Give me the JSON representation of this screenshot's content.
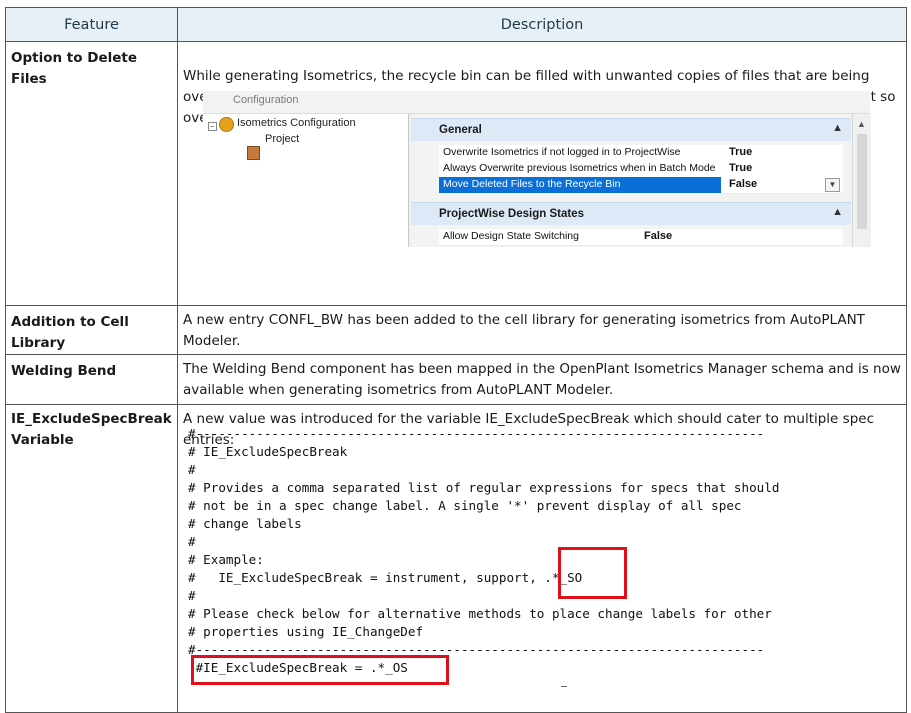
{
  "table": {
    "header": {
      "feature": "Feature",
      "description": "Description"
    },
    "rows": [
      {
        "feature": "Option to Delete Files",
        "description": "While generating Isometrics, the recycle bin can be filled with unwanted copies of files that are being overwritten. An option has been added to the Isometrics Configuration Project page which you can set so overwritten files are not sent to the recycle bin."
      },
      {
        "feature": "Addition to Cell Library",
        "description": "A new entry CONFL_BW has been added to the cell library for generating isometrics from AutoPLANT Modeler."
      },
      {
        "feature": "Welding Bend",
        "description": "The Welding Bend component has been mapped in the OpenPlant Isometrics Manager schema and is now available when generating isometrics from AutoPLANT Modeler."
      },
      {
        "feature": "IE_ExcludeSpecBreak Variable",
        "description": "A new value was introduced for the variable IE_ExcludeSpecBreak which should cater to multiple spec entries:"
      }
    ]
  },
  "screenshot": {
    "title": "Configuration",
    "tree": {
      "root": "Isometrics Configuration",
      "child": "Project"
    },
    "groups": [
      {
        "name": "General",
        "properties": [
          {
            "name": "Overwrite Isometrics if not logged in to ProjectWise",
            "value": "True"
          },
          {
            "name": "Always Overwrite previous Isometrics when in Batch Mode",
            "value": "True"
          },
          {
            "name": "Move Deleted Files to the Recycle Bin",
            "value": "False",
            "selected": true
          }
        ]
      },
      {
        "name": "ProjectWise Design States",
        "properties": [
          {
            "name": "Allow Design State Switching",
            "value": "False"
          }
        ]
      }
    ]
  },
  "code_lines": [
    "#---------------------------------------------------------------------------",
    "# IE_ExcludeSpecBreak",
    "#",
    "# Provides a comma separated list of regular expressions for specs that should",
    "# not be in a spec change label. A single '*' prevent display of all spec",
    "# change labels",
    "#",
    "# Example:",
    "#   IE_ExcludeSpecBreak = instrument, support, .*_SO",
    "#",
    "# Please check below for alternative methods to place change labels for other",
    "# properties using IE_ChangeDef",
    "#---------------------------------------------------------------------------",
    " #IE_ExcludeSpecBreak = .*_OS"
  ],
  "colors": {
    "header_bg": "#e6f0f6",
    "highlight_box": "#e0101a",
    "selection": "#0a6fd6"
  }
}
